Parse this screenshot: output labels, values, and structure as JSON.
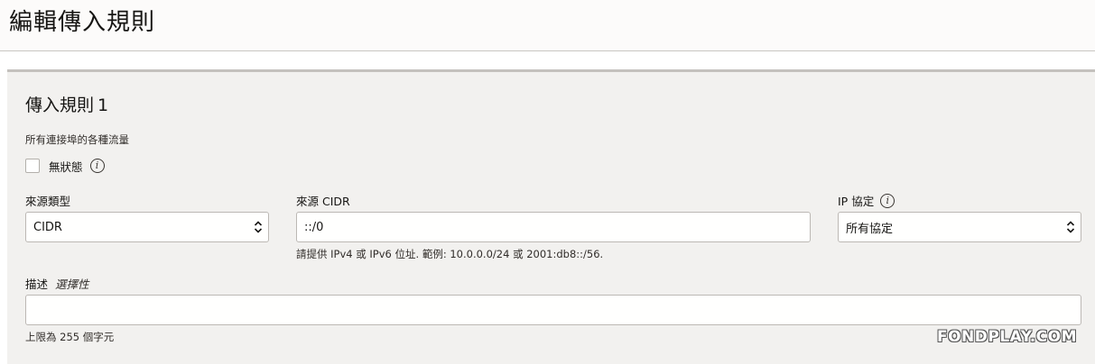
{
  "page": {
    "title": "編輯傳入規則"
  },
  "rule": {
    "title": "傳入規則",
    "number": "1",
    "traffic_label": "所有連接埠的各種流量",
    "stateless_label": "無狀態",
    "stateless_checked": false
  },
  "source_type": {
    "label": "來源類型",
    "value": "CIDR"
  },
  "source_cidr": {
    "label": "來源 CIDR",
    "value": "::/0",
    "hint": "請提供 IPv4 或 IPv6 位址. 範例: 10.0.0.0/24 或 2001:db8::/56."
  },
  "ip_protocol": {
    "label": "IP 協定",
    "value": "所有協定"
  },
  "description": {
    "label": "描述",
    "optional": "選擇性",
    "value": "",
    "hint": "上限為 255 個字元"
  },
  "watermark": "FONDPLAY.COM",
  "icons": {
    "info": "info-icon",
    "select": "chevron-updown-icon"
  },
  "colors": {
    "panel_bg": "#f2f1ef",
    "header_bg": "#fcfbfa"
  }
}
